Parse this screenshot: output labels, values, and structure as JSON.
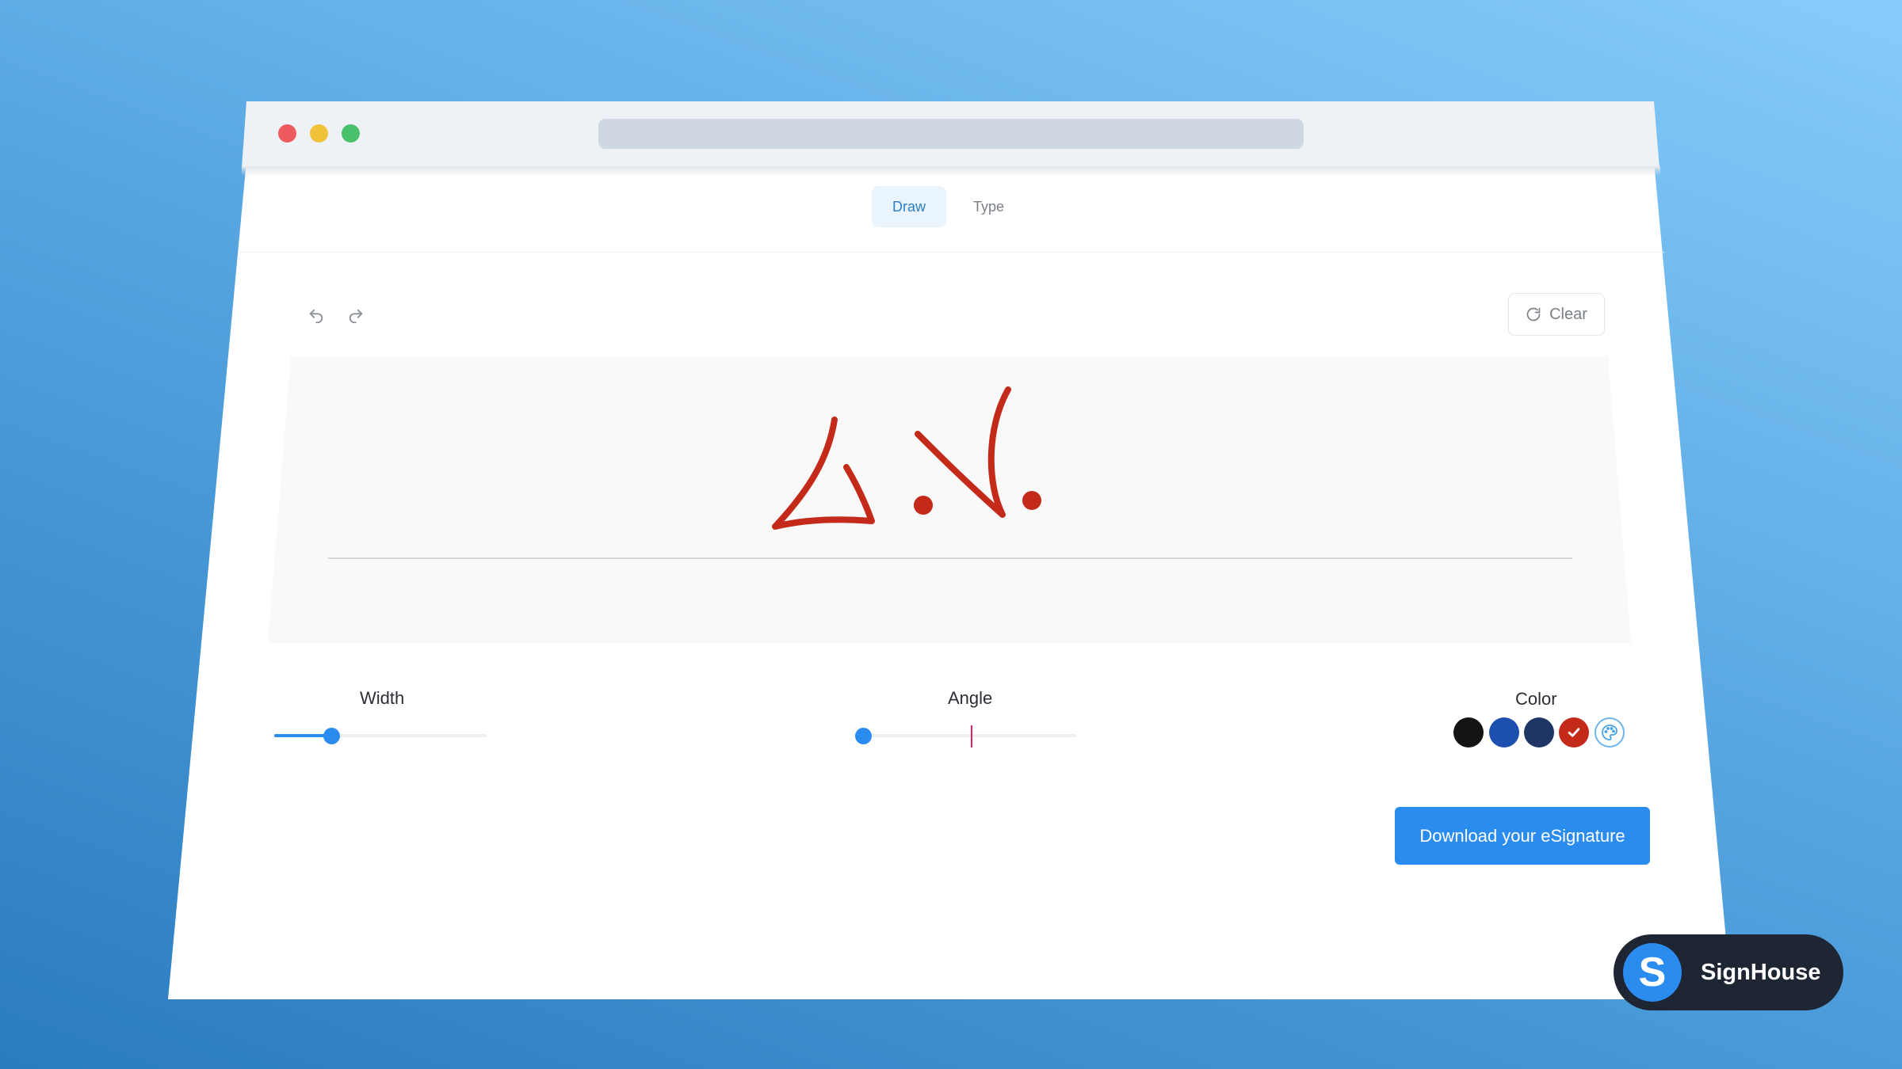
{
  "tabs": [
    {
      "label": "Draw",
      "active": true
    },
    {
      "label": "Type",
      "active": false
    }
  ],
  "toolbar": {
    "undo_icon": "undo-icon",
    "redo_icon": "redo-icon",
    "clear_label": "Clear",
    "clear_icon": "refresh-icon"
  },
  "signature": {
    "stroke_color": "#c42a1a"
  },
  "controls": {
    "width": {
      "label": "Width",
      "value": 0.27
    },
    "angle": {
      "label": "Angle",
      "value": 0.0
    },
    "color": {
      "label": "Color",
      "swatches": [
        "#141414",
        "#1c4fb0",
        "#1f3566",
        "#c42a1a"
      ],
      "selected": "#c42a1a",
      "custom_icon": "palette-icon"
    }
  },
  "download_label": "Download your eSignature",
  "brand": {
    "logo_letter": "S",
    "name": "SignHouse"
  },
  "colors": {
    "accent": "#2b8cf0",
    "background_start": "#2a7cc0",
    "background_end": "#86ccfb"
  }
}
